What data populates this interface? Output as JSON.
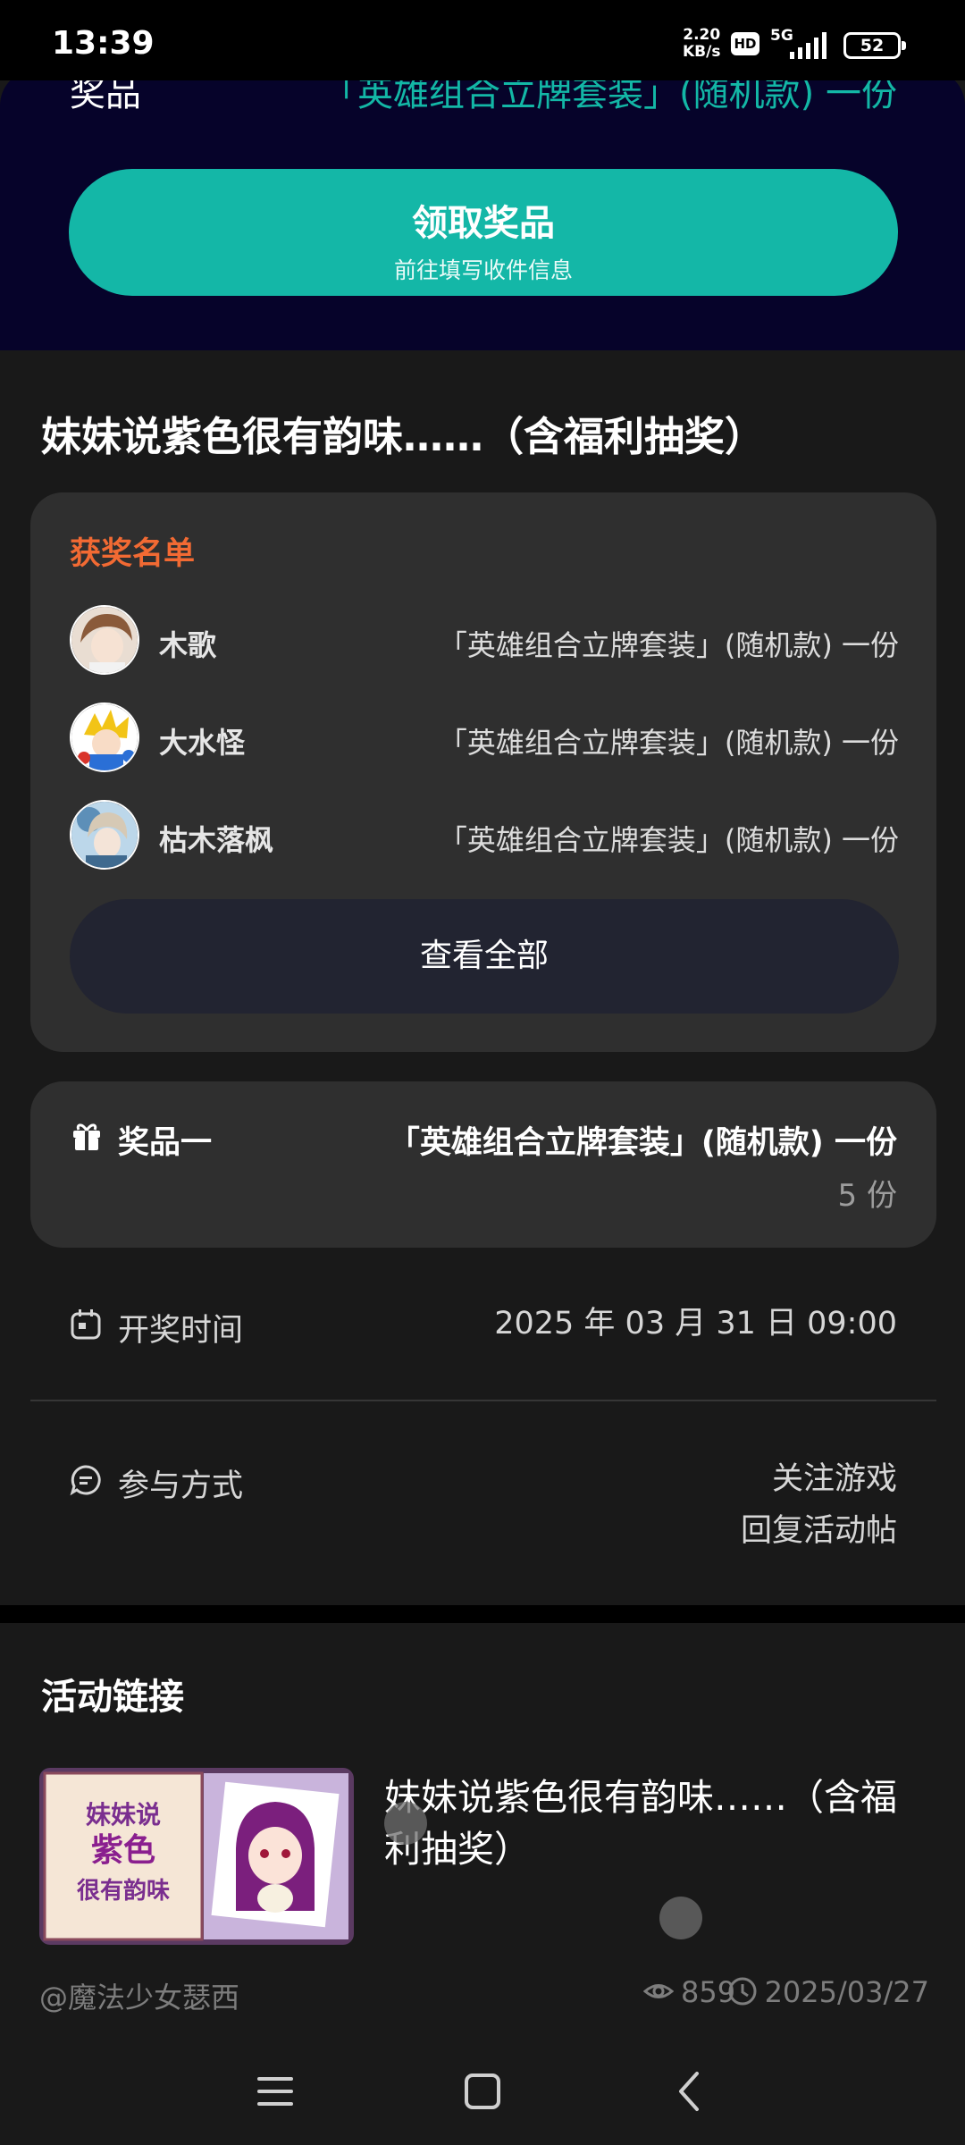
{
  "status_bar": {
    "time": "13:39",
    "speed_value": "2.20",
    "speed_unit": "KB/s",
    "hd": "HD",
    "network": "5G",
    "battery": "52"
  },
  "prize_banner": {
    "label": "奖品",
    "value": "「英雄组合立牌套装」(随机款) 一份",
    "claim_title": "领取奖品",
    "claim_subtitle": "前往填写收件信息"
  },
  "activity": {
    "title": "妹妹说紫色很有韵味……（含福利抽奖）"
  },
  "winners": {
    "heading": "获奖名单",
    "rows": [
      {
        "name": "木歌",
        "prize": "「英雄组合立牌套装」(随机款) 一份"
      },
      {
        "name": "大水怪",
        "prize": "「英雄组合立牌套装」(随机款) 一份"
      },
      {
        "name": "枯木落枫",
        "prize": "「英雄组合立牌套装」(随机款) 一份"
      }
    ],
    "view_all": "查看全部"
  },
  "prize": {
    "label": "奖品一",
    "value": "「英雄组合立牌套装」(随机款) 一份",
    "count": "5 份"
  },
  "draw_time": {
    "label": "开奖时间",
    "value": "2025 年 03 月 31 日 09:00"
  },
  "participation": {
    "label": "参与方式",
    "steps": [
      "关注游戏",
      "回复活动帖"
    ]
  },
  "links": {
    "heading": "活动链接",
    "card": {
      "title": "妹妹说紫色很有韵味……（含福利抽奖）",
      "author": "@魔法少女瑟西",
      "views": "859",
      "date": "2025/03/27"
    }
  },
  "colors": {
    "accent": "#14b7a7",
    "winners_heading": "#f26a33",
    "banner_bg": "#06032a"
  }
}
